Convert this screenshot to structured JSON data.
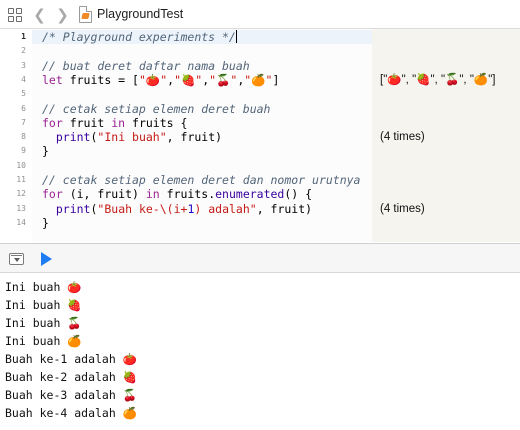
{
  "jumpbar": {
    "file_name": "PlaygroundTest",
    "back_glyph": "❮",
    "forward_glyph": "❯"
  },
  "editor": {
    "line_numbers": [
      "1",
      "2",
      "3",
      "4",
      "5",
      "6",
      "7",
      "8",
      "9",
      "10",
      "11",
      "12",
      "13",
      "14"
    ],
    "current_line": 1,
    "lines": {
      "l1": "/* Playground experiments */",
      "l3": "// buat deret daftar nama buah",
      "l4_let": "let",
      "l4_a": " fruits = [",
      "l4_s1": "\"🍅\"",
      "l4_c1": ",",
      "l4_s2": "\"🍓\"",
      "l4_c2": ",",
      "l4_s3": "\"🍒\"",
      "l4_c3": ",",
      "l4_s4": "\"🍊\"",
      "l4_end": "]",
      "l6": "// cetak setiap elemen deret buah",
      "l7_for": "for",
      "l7_a": " fruit ",
      "l7_in": "in",
      "l7_b": " fruits {",
      "l8_indent": "  ",
      "l8_print": "print",
      "l8_a": "(",
      "l8_str": "\"Ini buah\"",
      "l8_b": ", fruit)",
      "l9": "}",
      "l11": "// cetak setiap elemen deret dan nomor urutnya",
      "l12_for": "for",
      "l12_a": " (i, fruit) ",
      "l12_in": "in",
      "l12_b": " fruits.",
      "l12_fn": "enumerated",
      "l12_c": "() {",
      "l13_indent": "  ",
      "l13_print": "print",
      "l13_a": "(",
      "l13_str1": "\"Buah ke-\\(i+",
      "l13_num": "1",
      "l13_str2": ") adalah\"",
      "l13_b": ", fruit)",
      "l14": "}"
    }
  },
  "results": {
    "r4": "[\"🍅\", \"🍓\", \"🍒\", \"🍊\"]",
    "r8": "(4 times)",
    "r13": "(4 times)"
  },
  "console": {
    "lines": [
      "Ini buah 🍅",
      "Ini buah 🍓",
      "Ini buah 🍒",
      "Ini buah 🍊",
      "Buah ke-1 adalah 🍅",
      "Buah ke-2 adalah 🍓",
      "Buah ke-3 adalah 🍒",
      "Buah ke-4 adalah 🍊"
    ]
  },
  "colors": {
    "keyword": "#9b2393",
    "string": "#c41a16",
    "comment": "#536579",
    "number": "#1c00cf",
    "run_button": "#1e7cf2"
  },
  "icons": {
    "navigator": "grid-icon",
    "back": "chevron-left-icon",
    "forward": "chevron-right-icon",
    "file": "swift-file-icon",
    "debug_toggle": "hide-debug-area-icon",
    "run": "play-icon"
  }
}
